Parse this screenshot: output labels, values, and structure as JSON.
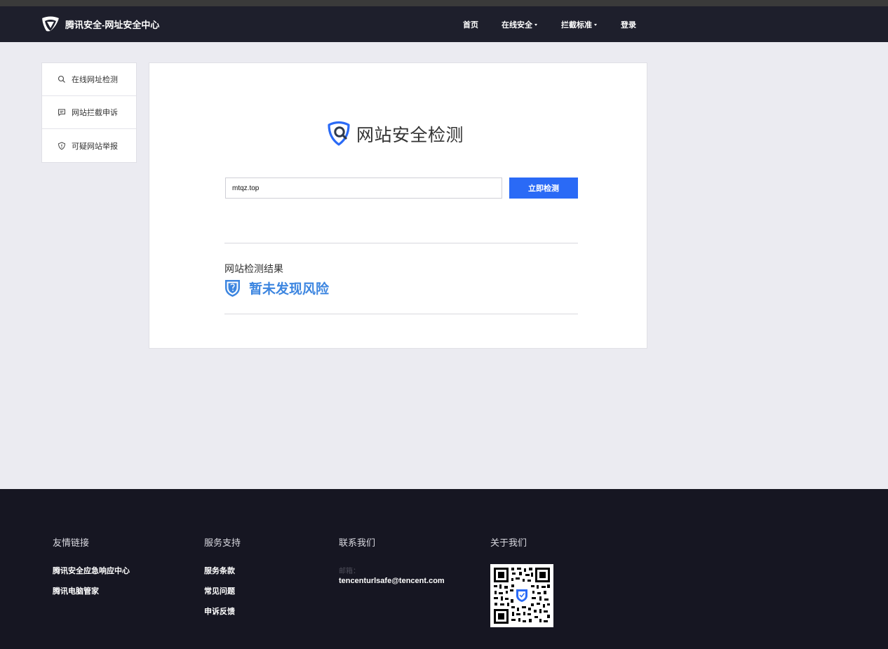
{
  "header": {
    "brand": "腾讯安全-网址安全中心",
    "nav": [
      {
        "label": "首页",
        "dropdown": false
      },
      {
        "label": "在线安全",
        "dropdown": true
      },
      {
        "label": "拦截标准",
        "dropdown": true
      },
      {
        "label": "登录",
        "dropdown": false
      }
    ]
  },
  "sidebar": {
    "items": [
      {
        "label": "在线网址检测",
        "icon": "search-icon"
      },
      {
        "label": "网站拦截申诉",
        "icon": "message-icon"
      },
      {
        "label": "可疑网站举报",
        "icon": "shield-alert-icon"
      }
    ]
  },
  "main": {
    "title": "网站安全检测",
    "url_value": "mtqz.top",
    "check_button": "立即检测",
    "result_title": "网站检测结果",
    "result_status": "暂未发现风险",
    "accent": "#2a6af6",
    "result_color": "#3d86e0"
  },
  "footer": {
    "friend_links": {
      "title": "友情链接",
      "items": [
        "腾讯安全应急响应中心",
        "腾讯电脑管家"
      ]
    },
    "support": {
      "title": "服务支持",
      "items": [
        "服务条款",
        "常见问题",
        "申诉反馈"
      ]
    },
    "contact": {
      "title": "联系我们",
      "email_label": "邮箱：",
      "email": "tencenturlsafe@tencent.com"
    },
    "about": {
      "title": "关于我们",
      "qr": "qr-code-icon"
    }
  }
}
